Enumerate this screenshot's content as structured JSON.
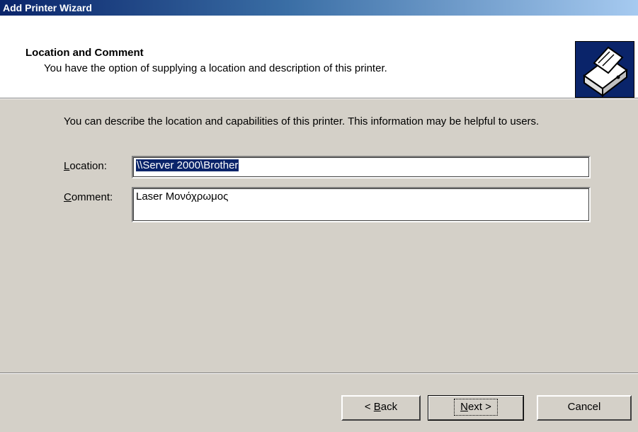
{
  "window": {
    "title": "Add Printer Wizard"
  },
  "header": {
    "title": "Location and Comment",
    "subtitle": "You have the option of supplying a location and description of this printer.",
    "icon": "printer-icon"
  },
  "intro": "You can describe the location and capabilities of this printer. This information may be helpful to users.",
  "fields": {
    "location": {
      "label_access": "L",
      "label_rest": "ocation:",
      "value": "\\\\Server 2000\\Brother"
    },
    "comment": {
      "label_access": "C",
      "label_rest": "omment:",
      "value": "Laser Μονόχρωμος"
    }
  },
  "buttons": {
    "back": {
      "prefix": "< ",
      "access": "B",
      "rest": "ack"
    },
    "next": {
      "access": "N",
      "rest": "ext >"
    },
    "cancel": {
      "label": "Cancel"
    }
  },
  "colors": {
    "titlebar_start": "#0a246a",
    "titlebar_end": "#a6caf0",
    "dialog_bg": "#d4d0c8",
    "selection": "#0a246a"
  }
}
